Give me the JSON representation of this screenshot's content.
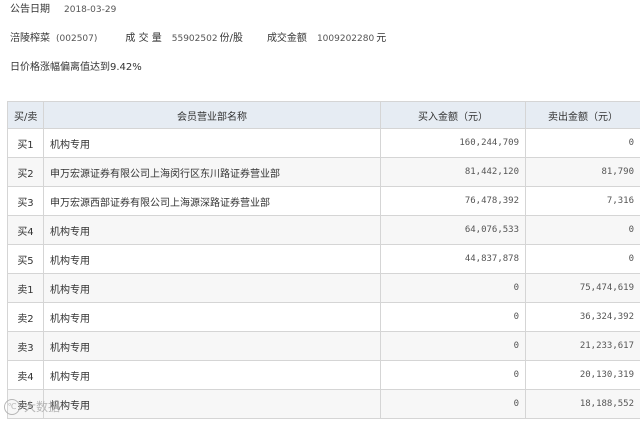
{
  "info": {
    "date_label": "公告日期",
    "date_value": "2018-03-29",
    "stock_name": "涪陵榨菜",
    "stock_code": "(002507)",
    "volume_label": "成 交 量",
    "volume_value": "55902502",
    "volume_unit": "份/股",
    "amount_label": "成交金额",
    "amount_value": "1009202280",
    "amount_unit": "元",
    "reason": "日价格涨幅偏离值达到9.42%"
  },
  "table": {
    "headers": [
      "买/卖",
      "会员营业部名称",
      "买入金额（元）",
      "卖出金额（元）"
    ],
    "rows": [
      {
        "side": "买1",
        "name": "机构专用",
        "buy": "160,244,709",
        "sell": "0"
      },
      {
        "side": "买2",
        "name": "申万宏源证券有限公司上海闵行区东川路证券营业部",
        "buy": "81,442,120",
        "sell": "81,790"
      },
      {
        "side": "买3",
        "name": "申万宏源西部证券有限公司上海源深路证券营业部",
        "buy": "76,478,392",
        "sell": "7,316"
      },
      {
        "side": "买4",
        "name": "机构专用",
        "buy": "64,076,533",
        "sell": "0"
      },
      {
        "side": "买5",
        "name": "机构专用",
        "buy": "44,837,878",
        "sell": "0"
      },
      {
        "side": "卖1",
        "name": "机构专用",
        "buy": "0",
        "sell": "75,474,619"
      },
      {
        "side": "卖2",
        "name": "机构专用",
        "buy": "0",
        "sell": "36,324,392"
      },
      {
        "side": "卖3",
        "name": "机构专用",
        "buy": "0",
        "sell": "21,233,617"
      },
      {
        "side": "卖4",
        "name": "机构专用",
        "buy": "0",
        "sell": "20,130,319"
      },
      {
        "side": "卖5",
        "name": "机构专用",
        "buy": "0",
        "sell": "18,188,552"
      }
    ]
  },
  "watermark": {
    "logo": "℃",
    "text": "大数据"
  }
}
